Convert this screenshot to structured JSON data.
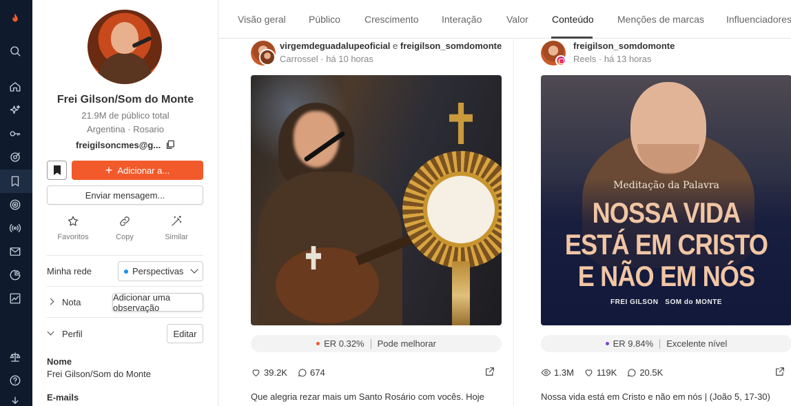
{
  "rail": {
    "icons": [
      "flame-logo-icon",
      "search-icon",
      "home-icon",
      "sparkles-icon",
      "key-icon",
      "target-check-icon",
      "bookmark-icon",
      "radar-icon",
      "broadcast-icon",
      "mail-icon",
      "pie-chart-icon",
      "trend-chart-icon",
      "scale-icon",
      "help-icon",
      "download-icon"
    ],
    "active": "bookmark-icon",
    "accent": "#f25a2b"
  },
  "profile": {
    "name": "Frei Gilson/Som do Monte",
    "audience": "21.9M de público total",
    "location": "Argentina · Rosario",
    "email": "freigilsoncmes@g...",
    "add_button": "Adicionar a...",
    "message_button": "Enviar mensagem...",
    "actions": [
      {
        "label": "Favoritos",
        "icon": "star-icon"
      },
      {
        "label": "Copy",
        "icon": "link-icon"
      },
      {
        "label": "Similar",
        "icon": "magic-wand-icon"
      }
    ],
    "network_label": "Minha rede",
    "network_value": "Perspectivas",
    "notes_label": "Nota",
    "notes_tooltip": "Adicionar uma observação",
    "perfil_label": "Perfil",
    "edit_button": "Editar",
    "fields": [
      {
        "label": "Nome",
        "value": "Frei Gilson/Som do Monte"
      },
      {
        "label": "E-mails",
        "value": ""
      }
    ]
  },
  "tabs": {
    "items": [
      "Visão geral",
      "Público",
      "Crescimento",
      "Interação",
      "Valor",
      "Conteúdo",
      "Menções de marcas",
      "Influenciadores"
    ],
    "active": "Conteúdo"
  },
  "posts": [
    {
      "author": "virgemdeguadalupeoficial",
      "connector": "e",
      "coauthor": "freigilson_somdomonte",
      "type": "Carrossel",
      "time": "há 10 horas",
      "er": "ER 0.32%",
      "er_rating": "Pode melhorar",
      "er_color": "#f25a2b",
      "likes": "39.2K",
      "comments": "674",
      "caption": "Que alegria rezar mais um Santo Rosário com vocês. Hoje"
    },
    {
      "author": "freigilson_somdomonte",
      "type": "Reels",
      "time": "há 13 horas",
      "image_text": {
        "brand": "Meditação da Palavra",
        "line1": "NOSSA VIDA",
        "line2": "ESTÁ EM CRISTO",
        "line3": "E NÃO EM NÓS",
        "signature": "FREI GILSON",
        "signature_brand": "SOM do MONTE"
      },
      "er": "ER 9.84%",
      "er_rating": "Excelente nível",
      "er_color": "#7b3fd9",
      "views": "1.3M",
      "likes": "119K",
      "comments": "20.5K",
      "caption": "Nossa vida está em Cristo e não em nós | (João 5, 17-30)"
    }
  ]
}
